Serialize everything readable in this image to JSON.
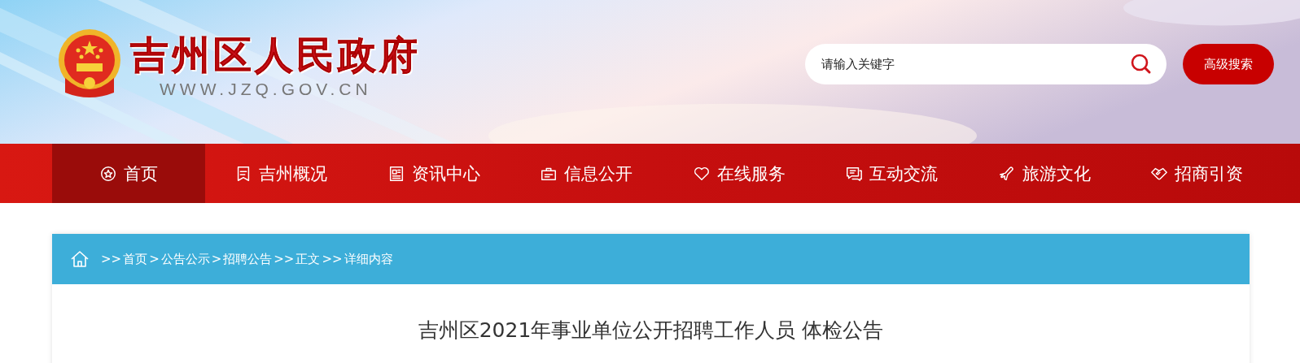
{
  "header": {
    "site_title": "吉州区人民政府",
    "site_url": "WWW.JZQ.GOV.CN",
    "search": {
      "placeholder": "请输入关键字"
    },
    "advanced_search_button": "高级搜索"
  },
  "nav": [
    {
      "label": "首页",
      "selected": true
    },
    {
      "label": "吉州概况",
      "selected": false
    },
    {
      "label": "资讯中心",
      "selected": false
    },
    {
      "label": "信息公开",
      "selected": false
    },
    {
      "label": "在线服务",
      "selected": false
    },
    {
      "label": "互动交流",
      "selected": false
    },
    {
      "label": "旅游文化",
      "selected": false
    },
    {
      "label": "招商引资",
      "selected": false
    }
  ],
  "breadcrumb": [
    {
      "kind": "sep",
      "text": ">>"
    },
    {
      "kind": "link",
      "text": "首页"
    },
    {
      "kind": "sep",
      "text": ">"
    },
    {
      "kind": "link",
      "text": "公告公示"
    },
    {
      "kind": "sep",
      "text": ">"
    },
    {
      "kind": "link",
      "text": "招聘公告"
    },
    {
      "kind": "sep",
      "text": ">>"
    },
    {
      "kind": "link",
      "text": "正文"
    },
    {
      "kind": "sep",
      "text": ">>"
    },
    {
      "kind": "link",
      "text": "详细内容"
    }
  ],
  "article": {
    "title": "吉州区2021年事业单位公开招聘工作人员 体检公告"
  }
}
